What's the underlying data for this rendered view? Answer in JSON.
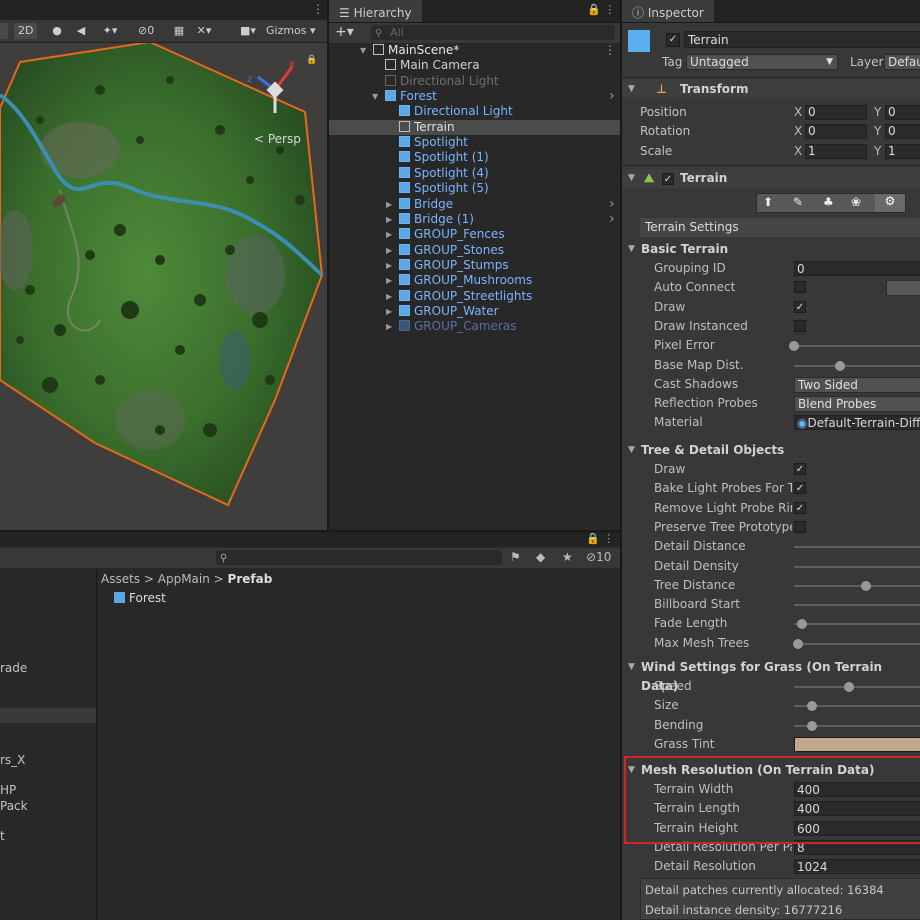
{
  "scene": {
    "toolbar": {
      "mode2d": "2D",
      "hidden_count": "0",
      "gizmos": "Gizmos"
    },
    "persp": "< Persp"
  },
  "hierarchy": {
    "tab": "Hierarchy",
    "search_placeholder": "All",
    "items": [
      {
        "label": "MainScene*",
        "style": "root"
      },
      {
        "label": "Main Camera",
        "style": "normal"
      },
      {
        "label": "Directional Light",
        "style": "gray"
      },
      {
        "label": "Forest",
        "style": "blue"
      },
      {
        "label": "Directional Light",
        "style": "blue"
      },
      {
        "label": "Terrain",
        "style": "selected"
      },
      {
        "label": "Spotlight",
        "style": "blue"
      },
      {
        "label": "Spotlight (1)",
        "style": "blue"
      },
      {
        "label": "Spotlight (4)",
        "style": "blue"
      },
      {
        "label": "Spotlight (5)",
        "style": "blue"
      },
      {
        "label": "Bridge",
        "style": "blue"
      },
      {
        "label": "Bridge (1)",
        "style": "blue"
      },
      {
        "label": "GROUP_Fences",
        "style": "blue"
      },
      {
        "label": "GROUP_Stones",
        "style": "blue"
      },
      {
        "label": "GROUP_Stumps",
        "style": "blue"
      },
      {
        "label": "GROUP_Mushrooms",
        "style": "blue"
      },
      {
        "label": "GROUP_Streetlights",
        "style": "blue"
      },
      {
        "label": "GROUP_Water",
        "style": "blue"
      },
      {
        "label": "GROUP_Cameras",
        "style": "dim"
      }
    ]
  },
  "project": {
    "hidden_count": "10",
    "breadcrumb": [
      "Assets",
      "AppMain",
      "Prefab"
    ],
    "asset": "Forest",
    "left_items": [
      "rade",
      "rs_X",
      "HP",
      "Pack",
      "t"
    ]
  },
  "inspector": {
    "tab": "Inspector",
    "object_name": "Terrain",
    "tag_label": "Tag",
    "tag_value": "Untagged",
    "layer_label": "Layer",
    "layer_value": "Defau",
    "transform": {
      "title": "Transform",
      "rows": [
        {
          "label": "Position",
          "x": "0",
          "y": "0"
        },
        {
          "label": "Rotation",
          "x": "0",
          "y": "0"
        },
        {
          "label": "Scale",
          "x": "1",
          "y": "1"
        }
      ]
    },
    "terrain_title": "Terrain",
    "settings_label": "Terrain Settings",
    "basic": {
      "title": "Basic Terrain"
    },
    "rows_basic": [
      {
        "label": "Grouping ID",
        "kind": "field",
        "value": "0"
      },
      {
        "label": "Auto Connect",
        "kind": "check",
        "value": ""
      },
      {
        "label": "Draw",
        "kind": "check",
        "value": "✓"
      },
      {
        "label": "Draw Instanced",
        "kind": "check",
        "value": ""
      },
      {
        "label": "Pixel Error",
        "kind": "slider",
        "value": 0.0
      },
      {
        "label": "Base Map Dist.",
        "kind": "slider",
        "value": 0.35
      },
      {
        "label": "Cast Shadows",
        "kind": "drop",
        "value": "Two Sided"
      },
      {
        "label": "Reflection Probes",
        "kind": "drop",
        "value": "Blend Probes"
      },
      {
        "label": "Material",
        "kind": "mat",
        "value": "Default-Terrain-Diffu"
      }
    ],
    "tree": {
      "title": "Tree & Detail Objects"
    },
    "rows_tree": [
      {
        "label": "Draw",
        "kind": "check",
        "value": "✓"
      },
      {
        "label": "Bake Light Probes For Tre",
        "kind": "check",
        "value": "✓"
      },
      {
        "label": "Remove Light Probe Ringi",
        "kind": "check",
        "value": "✓"
      },
      {
        "label": "Preserve Tree Prototype I",
        "kind": "check",
        "value": ""
      },
      {
        "label": "Detail Distance",
        "kind": "slider",
        "value": -1
      },
      {
        "label": "Detail Density",
        "kind": "slider",
        "value": -1
      },
      {
        "label": "Tree Distance",
        "kind": "slider",
        "value": 0.55
      },
      {
        "label": "Billboard Start",
        "kind": "slider",
        "value": -1
      },
      {
        "label": "Fade Length",
        "kind": "slider",
        "value": 0.06
      },
      {
        "label": "Max Mesh Trees",
        "kind": "slider",
        "value": 0.03
      }
    ],
    "wind": {
      "title": "Wind Settings for Grass (On Terrain Data)"
    },
    "rows_wind": [
      {
        "label": "Speed",
        "kind": "slider",
        "value": 0.42
      },
      {
        "label": "Size",
        "kind": "slider",
        "value": 0.14
      },
      {
        "label": "Bending",
        "kind": "slider",
        "value": 0.14
      },
      {
        "label": "Grass Tint",
        "kind": "color",
        "value": "#c4a88b"
      }
    ],
    "mesh": {
      "title": "Mesh Resolution (On Terrain Data)"
    },
    "rows_mesh": [
      {
        "label": "Terrain Width",
        "kind": "field",
        "value": "400"
      },
      {
        "label": "Terrain Length",
        "kind": "field",
        "value": "400"
      },
      {
        "label": "Terrain Height",
        "kind": "field",
        "value": "600"
      },
      {
        "label": "Detail Resolution Per Patc",
        "kind": "field",
        "value": "8"
      },
      {
        "label": "Detail Resolution",
        "kind": "field",
        "value": "1024"
      }
    ],
    "info": [
      "Detail patches currently allocated: 16384",
      "Detail instance density: 16777216"
    ]
  }
}
